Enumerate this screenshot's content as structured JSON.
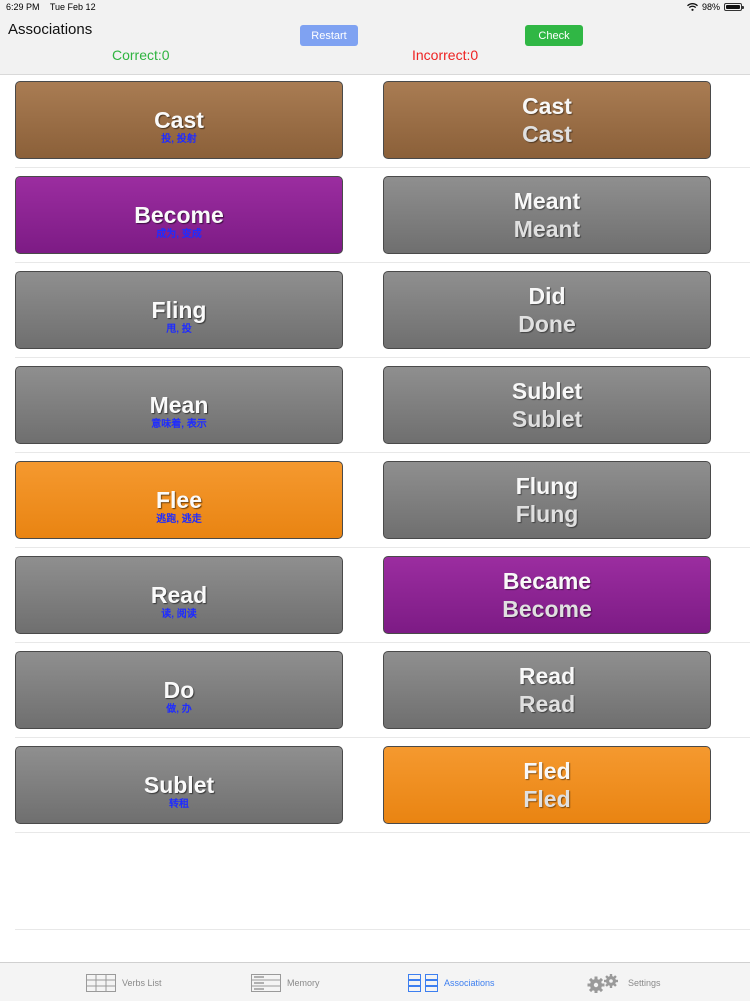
{
  "status_bar": {
    "time": "6:29 PM",
    "date": "Tue Feb 12",
    "battery": "98%",
    "battery_level": 0.98
  },
  "header": {
    "title": "Associations",
    "restart_label": "Restart",
    "check_label": "Check",
    "correct_text": "Correct:0",
    "incorrect_text": "Incorrect:0"
  },
  "colors": {
    "gray": "#808080",
    "brown": "#9c6f47",
    "purple": "#8c2492",
    "orange": "#f08f20",
    "correct": "#2fb440",
    "incorrect": "#ee2222",
    "meaning_text": "#1f2cff"
  },
  "left_cards": [
    {
      "word": "Cast",
      "meaning": "投, 投射",
      "color": "brown"
    },
    {
      "word": "Become",
      "meaning": "成为, 变成",
      "color": "purple"
    },
    {
      "word": "Fling",
      "meaning": "甩, 投",
      "color": "gray"
    },
    {
      "word": "Mean",
      "meaning": "意味着, 表示",
      "color": "gray"
    },
    {
      "word": "Flee",
      "meaning": "逃跑, 逃走",
      "color": "orange"
    },
    {
      "word": "Read",
      "meaning": "读, 阅读",
      "color": "gray"
    },
    {
      "word": "Do",
      "meaning": "做, 办",
      "color": "gray"
    },
    {
      "word": "Sublet",
      "meaning": "转租",
      "color": "gray"
    }
  ],
  "right_cards": [
    {
      "form1": "Cast",
      "form2": "Cast",
      "color": "brown"
    },
    {
      "form1": "Meant",
      "form2": "Meant",
      "color": "gray"
    },
    {
      "form1": "Did",
      "form2": "Done",
      "color": "gray"
    },
    {
      "form1": "Sublet",
      "form2": "Sublet",
      "color": "gray"
    },
    {
      "form1": "Flung",
      "form2": "Flung",
      "color": "gray"
    },
    {
      "form1": "Became",
      "form2": "Become",
      "color": "purple"
    },
    {
      "form1": "Read",
      "form2": "Read",
      "color": "gray"
    },
    {
      "form1": "Fled",
      "form2": "Fled",
      "color": "orange"
    }
  ],
  "tab_bar": {
    "tabs": [
      {
        "label": "Verbs List",
        "icon": "list-icon",
        "active": false
      },
      {
        "label": "Memory",
        "icon": "memory-icon",
        "active": false
      },
      {
        "label": "Associations",
        "icon": "associations-icon",
        "active": true
      },
      {
        "label": "Settings",
        "icon": "gears-icon",
        "active": false
      }
    ]
  }
}
